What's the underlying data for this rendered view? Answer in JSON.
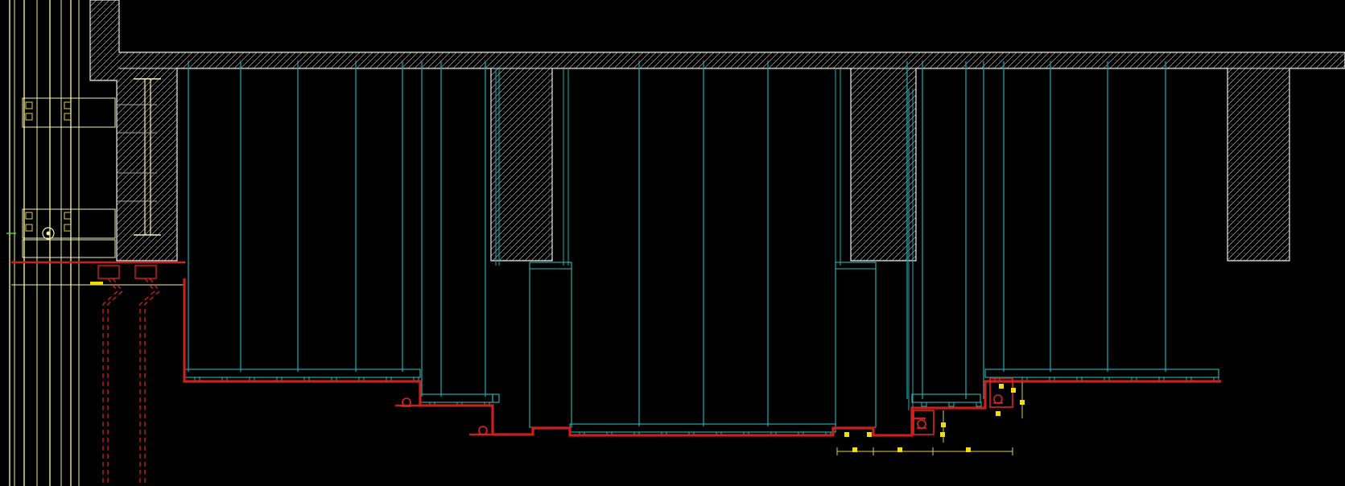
{
  "canvas": {
    "background": "#000000"
  },
  "palette": {
    "concrete_outline": "#e8e8e8",
    "concrete_hatch": "#bcbcbc",
    "hanger_rod": "#1f9ea3",
    "ceiling_board": "#2fb5b5",
    "finish_line": "#c8201c",
    "steel_frame": "#f0f0b0",
    "mullion": "#eeee88",
    "dimension": "#e0d040",
    "dimension_tick": "#f2e000",
    "equipment": "#e02222"
  },
  "drawing": {
    "type": "cad-ceiling-section",
    "text_labels": []
  }
}
